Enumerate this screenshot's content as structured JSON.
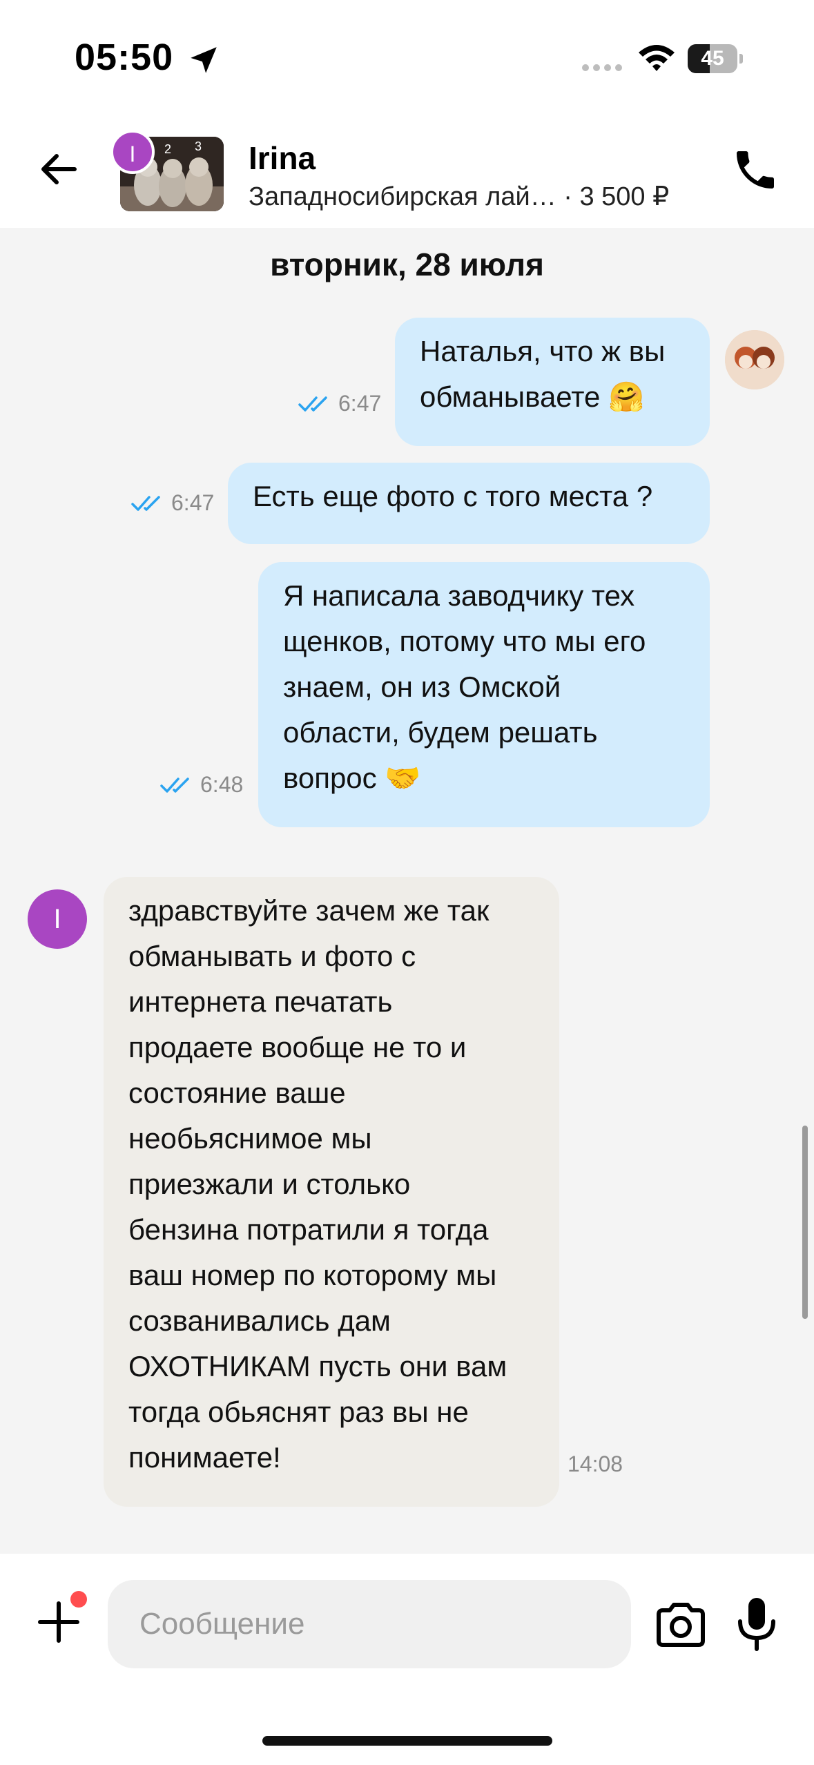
{
  "status_bar": {
    "time": "05:50",
    "battery_level": 45,
    "battery_text": "45"
  },
  "header": {
    "contact_name": "Irina",
    "contact_initial": "I",
    "listing_title": "Западносибирская лай…",
    "listing_price": " · 3 500 ₽"
  },
  "chat": {
    "date_separator": "вторник, 28 июля",
    "messages": [
      {
        "direction": "outgoing",
        "lines": [
          "Наталья, что ж вы",
          "обманываете 🤗"
        ],
        "time": "6:47"
      },
      {
        "direction": "outgoing",
        "lines": [
          "Есть еще фото с того места ?"
        ],
        "time": "6:47"
      },
      {
        "direction": "outgoing",
        "lines": [
          "Я написала заводчику тех",
          "щенков, потому что мы его",
          "знаем, он из Омской",
          "области, будем решать",
          "вопрос 🤝"
        ],
        "time": "6:48"
      },
      {
        "direction": "incoming",
        "author_initial": "I",
        "lines": [
          "здравствуйте зачем же так",
          "обманывать и фото с",
          "интернета печатать",
          "продаете вообще не то и",
          "состояние ваше",
          "необьяснимое мы",
          "приезжали и столько",
          "бензина потратили я тогда",
          "ваш номер по которому мы",
          "созванивались дам",
          "ОХОТНИКАМ пусть они вам",
          "тогда обьяснят раз вы не",
          "понимаете!"
        ],
        "time": "14:08"
      }
    ]
  },
  "composer": {
    "placeholder": "Сообщение"
  },
  "colors": {
    "outgoing_bubble": "#d3ecfd",
    "incoming_bubble": "#efede8",
    "avatar_purple": "#a946c2",
    "read_ticks": "#2aa3f0",
    "notification_dot": "#ff4d4f"
  },
  "icons": [
    "location-arrow-icon",
    "signal-dots-icon",
    "wifi-icon",
    "battery-icon",
    "back-arrow-icon",
    "phone-icon",
    "read-ticks-icon",
    "plus-icon",
    "camera-icon",
    "microphone-icon"
  ]
}
